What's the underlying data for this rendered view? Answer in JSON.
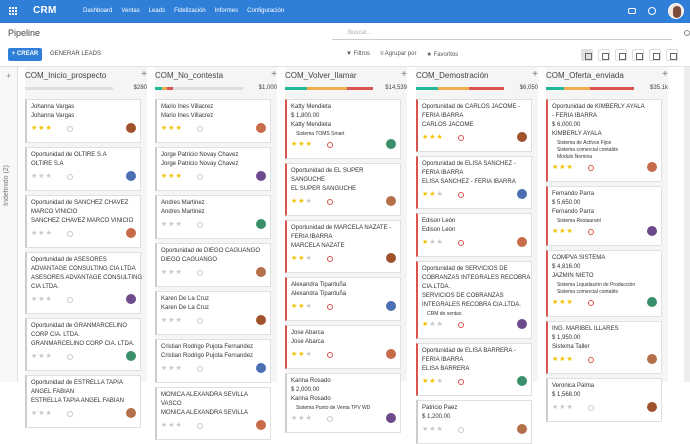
{
  "app": {
    "name": "CRM"
  },
  "menu": [
    "Dashboard",
    "Ventas",
    "Leads",
    "Fidelización",
    "Informes",
    "Configuración"
  ],
  "header": {
    "title": "Pipeline"
  },
  "search": {
    "placeholder": "Buscar..."
  },
  "toolbar": {
    "crear_label": "+ CREAR",
    "generar_label": "GENERAR LEADS"
  },
  "filters": {
    "filtros": "▼ Filtros",
    "agrupar": "≡ Agrupar por",
    "favoritos": "★ Favoritos"
  },
  "folded_column": {
    "label": "Indefinido (2)"
  },
  "colors": {
    "accent": "#2f7fd8",
    "star": "#f3c100",
    "green": "#21b799",
    "red": "#d9534f",
    "yellow": "#f0ad4e"
  },
  "columns": [
    {
      "title": "COM_Inicio_prospecto",
      "amount": "$280",
      "cards": [
        {
          "lines": [
            "Johanna Vargas",
            "Johanna Vargas"
          ],
          "stars": 3,
          "dot": "grey"
        },
        {
          "lines": [
            "Oportunidad de OLTIRE S.A",
            "OLTIRE S.A"
          ],
          "stars": 0,
          "dot": "grey"
        },
        {
          "lines": [
            "Oportunidad de SANCHEZ CHAVEZ",
            "MARCO VINICIO",
            "SANCHEZ CHAVEZ MARCO VINICIO"
          ],
          "stars": 0,
          "dot": "grey"
        },
        {
          "lines": [
            "Oportunidad de ASESORES",
            "ADVANTAGE CONSULTING CIA LTDA",
            "ASESORES ADVANTAGE CONSULTING",
            "CIA LTDA."
          ],
          "stars": 0,
          "dot": "grey"
        },
        {
          "lines": [
            "Oportunidad de GRANMARCELINO",
            "CORP CIA. LTDA.",
            "GRANMARCELINO CORP CIA. LTDA."
          ],
          "stars": 0,
          "dot": "grey"
        },
        {
          "lines": [
            "Oportunidad de ESTRELLA TAPIA",
            "ANGEL FABIAN",
            "ESTRELLA TAPIA ANGEL FABIAN"
          ],
          "stars": 0,
          "dot": "grey"
        }
      ]
    },
    {
      "title": "COM_No_contesta",
      "amount": "$1,000",
      "cards": [
        {
          "lines": [
            "Mario Ines Villacrez",
            "Mario Ines Villacrez"
          ],
          "stars": 3,
          "dot": "grey"
        },
        {
          "lines": [
            "Jorge Patricio Novay Chavez",
            "Jorge Patricio Novay Chavez"
          ],
          "stars": 3,
          "dot": "grey"
        },
        {
          "lines": [
            "Andres Martinez",
            "Andres Martinez"
          ],
          "stars": 0,
          "dot": "grey"
        },
        {
          "lines": [
            "Oportunidad de DIEGO CAGUANGO",
            "DIEGO CAGUANGO"
          ],
          "stars": 0,
          "dot": "grey"
        },
        {
          "lines": [
            "Karen De La Cruz",
            "Karen De La Cruz"
          ],
          "stars": 0,
          "dot": "grey"
        },
        {
          "lines": [
            "Cristian Rodrigo Pujota Fernandez",
            "Cristian Rodrigo Pujota Fernandez"
          ],
          "stars": 0,
          "dot": "grey"
        },
        {
          "lines": [
            "MONICA ALEXANDRA SEVILLA",
            "VASCO",
            "MONICA ALEXANDRA SEVILLA"
          ],
          "stars": 0,
          "dot": "grey"
        }
      ]
    },
    {
      "title": "COM_Volver_llamar",
      "amount": "$14,539",
      "cards": [
        {
          "lines": [
            "Katty Mendieta",
            "$ 1,800.00",
            "Katty Mendieta"
          ],
          "tag": "Sistema TOMS Smart",
          "stars": 3,
          "dot": "red"
        },
        {
          "lines": [
            "Oportunidad de EL SUPER",
            "SANGUCHE",
            "EL SUPER SANGUCHE"
          ],
          "stars": 2,
          "dot": "red"
        },
        {
          "lines": [
            "Oportunidad de MARCELA NAZATE -",
            "FERIA IBARRA",
            "MARCELA NAZATE"
          ],
          "stars": 2,
          "dot": "red"
        },
        {
          "lines": [
            "Alexandra Tipantuña",
            "Alexandra Tipantuña"
          ],
          "stars": 2,
          "dot": "red"
        },
        {
          "lines": [
            "Jose Abarca",
            "Jose Abarca"
          ],
          "stars": 2,
          "dot": "red"
        },
        {
          "lines": [
            "Karina Rosado",
            "$ 2,000.00",
            "Karina Rosado"
          ],
          "tag": "Sistema Punto de Venta TPV WD",
          "stars": 0,
          "dot": "grey"
        }
      ]
    },
    {
      "title": "COM_Demostración",
      "amount": "$6,050",
      "cards": [
        {
          "lines": [
            "Oportunidad de CARLOS JACOME -",
            "FERIA IBARRA",
            "CARLOS JACOME"
          ],
          "stars": 3,
          "dot": "red"
        },
        {
          "lines": [
            "Oportunidad de ELISA SANCHEZ -",
            "FERIA IBARRA",
            "ELISA SANCHEZ - FERIA IBARRA"
          ],
          "stars": 2,
          "dot": "red"
        },
        {
          "lines": [
            "Edison León",
            "Edison León"
          ],
          "stars": 1,
          "dot": "red"
        },
        {
          "lines": [
            "Oportunidad de SERVICIOS DE",
            "COBRANZAS INTEGRALES RECOBRA",
            "CIA.LTDA.",
            "SERVICIOS DE COBRANZAS",
            "INTEGRALES RECOBRA CIA.LTDA."
          ],
          "tag": "CRM de ventas",
          "stars": 1,
          "dot": "red"
        },
        {
          "lines": [
            "Oportunidad de ELISA BARRERA -",
            "FERIA IBARRA",
            "ELISA BARRERA"
          ],
          "stars": 2,
          "dot": "red"
        },
        {
          "lines": [
            "Patricio Paez",
            "$ 1,200.00"
          ],
          "stars": 0,
          "dot": "grey"
        }
      ]
    },
    {
      "title": "COM_Oferta_enviada",
      "amount": "$35.1k",
      "cards": [
        {
          "lines": [
            "Oportunidad de KIMBERLY AYALA",
            "- FERIA IBARRA",
            "$ 6,000.00",
            "KIMBERLY AYALA"
          ],
          "tags": [
            "Sistema de Activos Fijos",
            "Sistema comercial contable",
            "Modulo Nomina"
          ],
          "stars": 3,
          "dot": "red"
        },
        {
          "lines": [
            "Fernando Parra",
            "$ 5,650.00",
            "Fernando Parra"
          ],
          "tag": "Sistema Restaurant",
          "stars": 3,
          "dot": "red"
        },
        {
          "lines": [
            "COMPVA SISTEMA",
            "$ 4,816.00",
            "JAZMIN NIETO"
          ],
          "tags": [
            "Sistema Liquidación de Producción",
            "Sistema comercial contable"
          ],
          "stars": 3,
          "dot": "red"
        },
        {
          "lines": [
            "ING. MARIBEL ILLARES",
            "$ 1,950.00",
            "Sistema Taller"
          ],
          "stars": 3,
          "dot": "red"
        },
        {
          "lines": [
            "Veronica Palma",
            "$ 1,568.00"
          ],
          "stars": 0,
          "dot": "grey"
        }
      ]
    }
  ]
}
